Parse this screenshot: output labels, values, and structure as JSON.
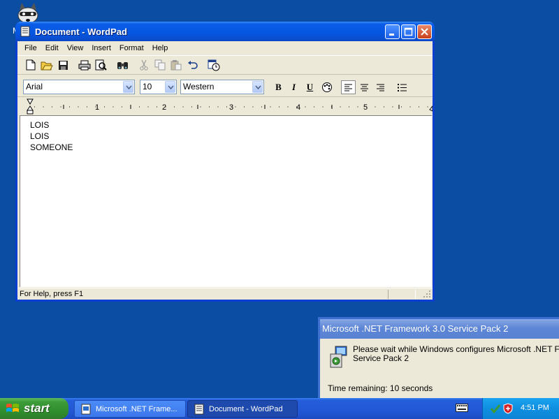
{
  "desktop": {
    "icon_label": "M"
  },
  "wordpad": {
    "title": "Document - WordPad",
    "menu": [
      "File",
      "Edit",
      "View",
      "Insert",
      "Format",
      "Help"
    ],
    "toolbar_icons": [
      "new-icon",
      "open-icon",
      "save-icon",
      "print-icon",
      "print-preview-icon",
      "find-icon",
      "cut-icon",
      "copy-icon",
      "paste-icon",
      "undo-icon",
      "date-time-icon"
    ],
    "font_name": "Arial",
    "font_size": "10",
    "script": "Western",
    "format_buttons": {
      "bold": "B",
      "italic": "I",
      "underline": "U"
    },
    "ruler_numbers": [
      "1",
      "2",
      "3",
      "4",
      "5"
    ],
    "document_lines": [
      "LOIS",
      "LOIS",
      "SOMEONE"
    ],
    "status": "For Help, press F1"
  },
  "notification": {
    "title": "Microsoft .NET Framework 3.0 Service Pack 2",
    "message_line1": "Please wait while Windows configures Microsoft .NET Framework",
    "message_line2": "Service Pack 2",
    "time_remaining": "Time remaining: 10 seconds"
  },
  "taskbar": {
    "start_label": "start",
    "tasks": [
      {
        "label": "Microsoft .NET Frame...",
        "active": false
      },
      {
        "label": "Document - WordPad",
        "active": true
      }
    ],
    "clock": "4:51 PM"
  },
  "colors": {
    "desktop_bg": "#0a4da2",
    "titlebar_blue": "#0557e2",
    "taskbar_blue": "#245edb",
    "start_green": "#3c9b38",
    "window_face": "#ece9d8"
  }
}
